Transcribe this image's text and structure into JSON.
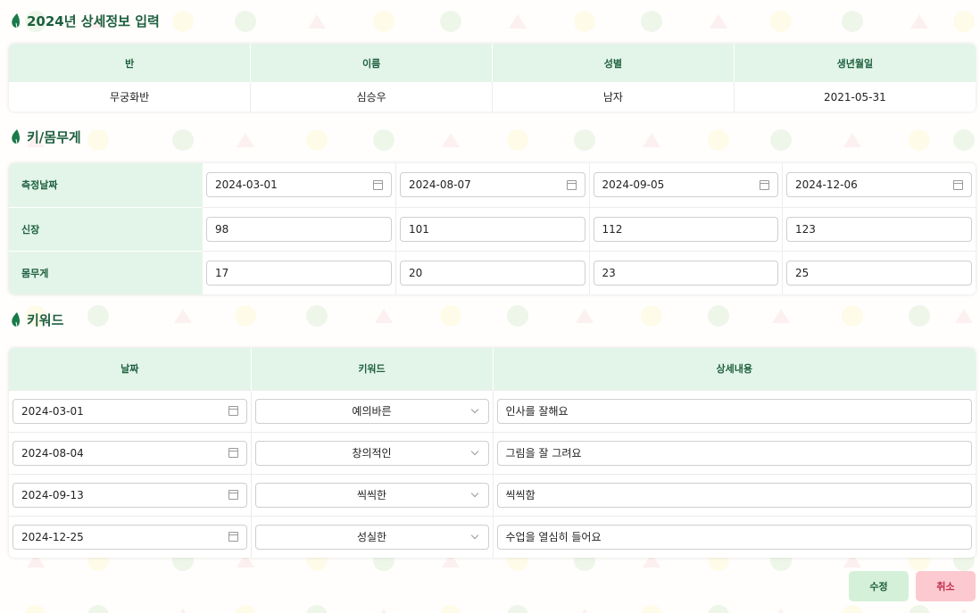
{
  "colors": {
    "header_bg": "#e3f5e8",
    "accent_green": "#1d5f3e",
    "save_bg": "#d5f0d8",
    "cancel_bg": "#fbc9cf",
    "cancel_text": "#c2294a"
  },
  "info_section": {
    "title": "2024년 상세정보 입력",
    "icon": "leaf-icon",
    "headers": [
      "반",
      "이름",
      "성별",
      "생년월일"
    ],
    "values": [
      "무궁화반",
      "심승우",
      "남자",
      "2021-05-31"
    ]
  },
  "growth_section": {
    "title": "키/몸무게",
    "icon": "leaf-icon",
    "rows": [
      {
        "label": "측정날짜",
        "type": "date",
        "values": [
          "2024-03-01",
          "2024-08-07",
          "2024-09-05",
          "2024-12-06"
        ]
      },
      {
        "label": "신장",
        "type": "text",
        "values": [
          "98",
          "101",
          "112",
          "123"
        ]
      },
      {
        "label": "몸무게",
        "type": "text",
        "values": [
          "17",
          "20",
          "23",
          "25"
        ]
      }
    ]
  },
  "keyword_section": {
    "title": "키워드",
    "icon": "leaf-icon",
    "headers": [
      "날짜",
      "키워드",
      "상세내용"
    ],
    "rows": [
      {
        "date": "2024-03-01",
        "keyword": "예의바른",
        "detail": "인사를 잘해요"
      },
      {
        "date": "2024-08-04",
        "keyword": "창의적인",
        "detail": "그림을 잘 그려요"
      },
      {
        "date": "2024-09-13",
        "keyword": "씩씩한",
        "detail": "씩씩함"
      },
      {
        "date": "2024-12-25",
        "keyword": "성실한",
        "detail": "수업을 열심히 들어요"
      }
    ]
  },
  "actions": {
    "save_label": "수정",
    "cancel_label": "취소"
  }
}
